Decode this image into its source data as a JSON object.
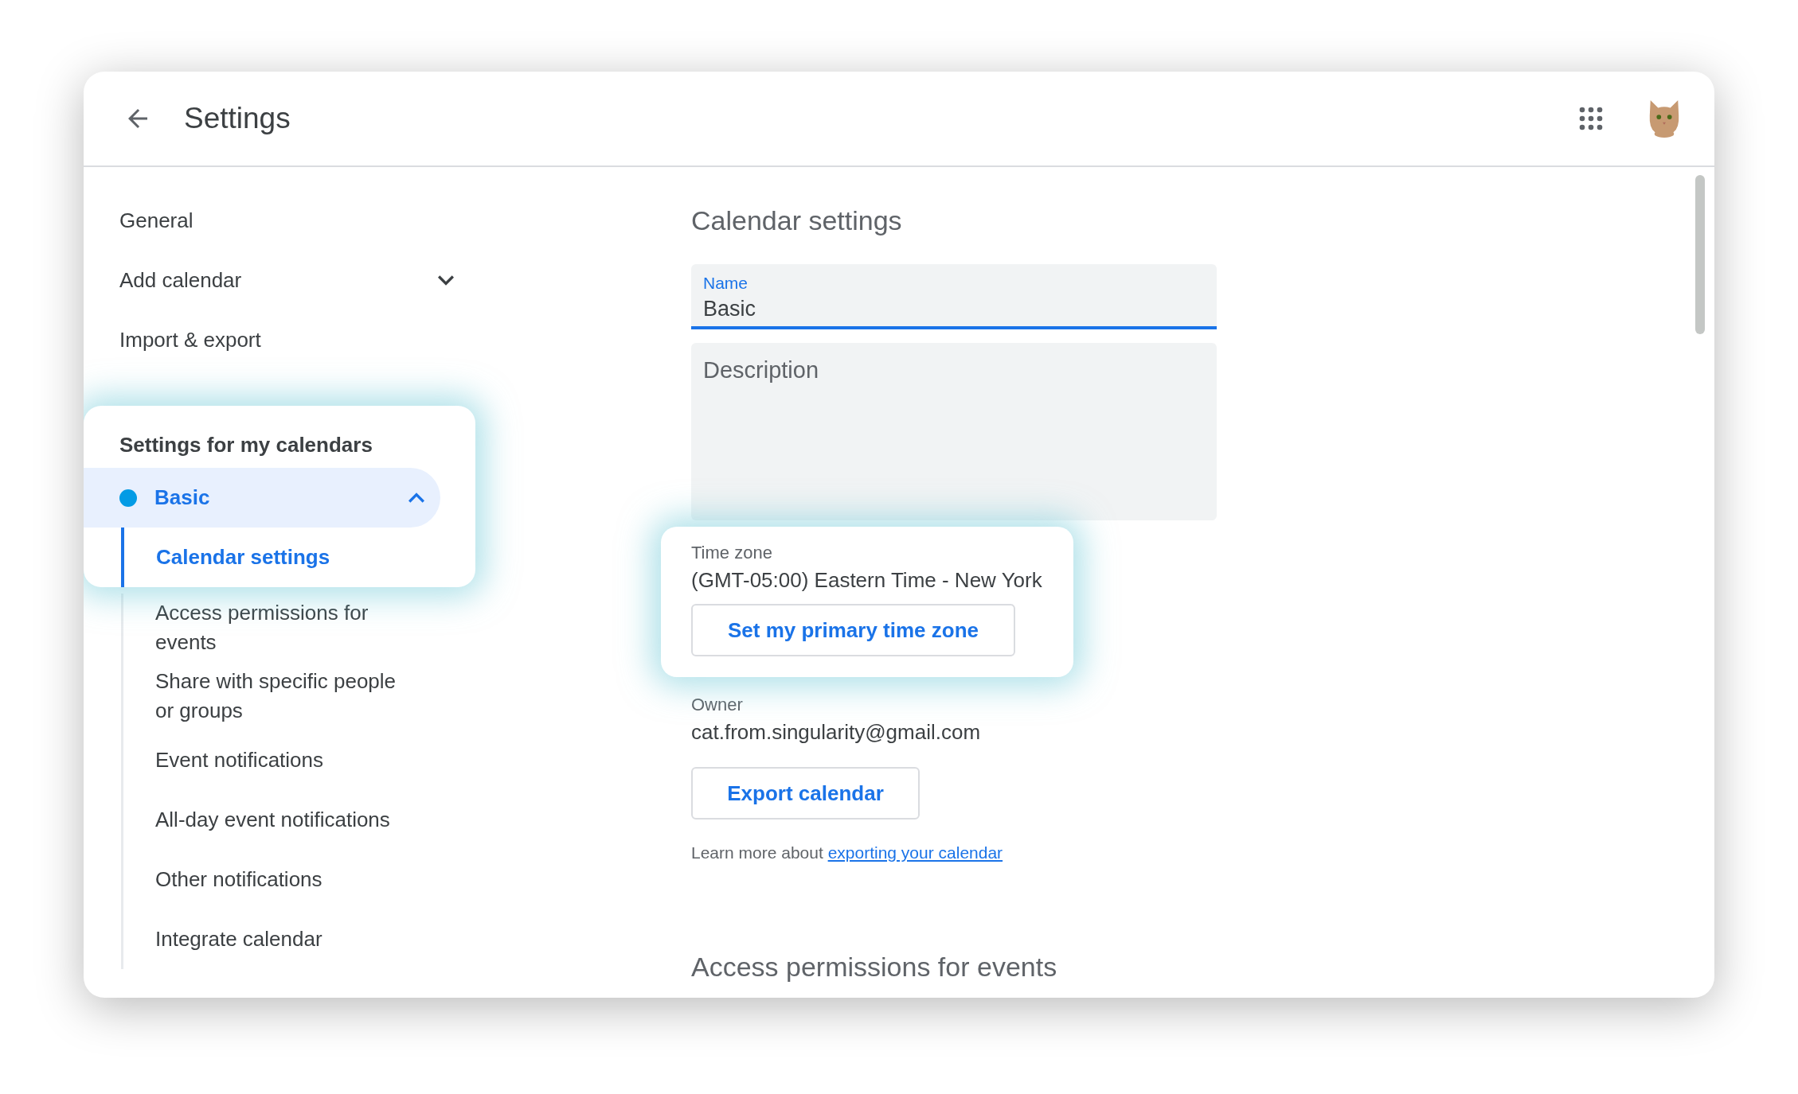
{
  "header": {
    "title": "Settings"
  },
  "sidebar": {
    "items": [
      {
        "label": "General",
        "kind": "link"
      },
      {
        "label": "Add calendar",
        "kind": "expandable",
        "expanded": false
      },
      {
        "label": "Import & export",
        "kind": "link"
      }
    ],
    "my_calendars": {
      "heading": "Settings for my calendars",
      "spotlight": true,
      "calendar": {
        "name": "Basic",
        "color": "#039be5",
        "expanded": true,
        "selected": true
      },
      "sub_items": [
        {
          "label": "Calendar settings",
          "selected": true,
          "spotlight": true
        },
        {
          "label": "Access permissions for events",
          "selected": false,
          "spotlight": false
        },
        {
          "label": "Share with specific people or groups",
          "selected": false,
          "spotlight": false
        },
        {
          "label": "Event notifications",
          "selected": false,
          "spotlight": false
        },
        {
          "label": "All-day event notifications",
          "selected": false,
          "spotlight": false
        },
        {
          "label": "Other notifications",
          "selected": false,
          "spotlight": false
        },
        {
          "label": "Integrate calendar",
          "selected": false,
          "spotlight": false
        }
      ]
    }
  },
  "main": {
    "heading": "Calendar settings",
    "name_field": {
      "label": "Name",
      "value": "Basic",
      "focused": true
    },
    "description_field": {
      "placeholder": "Description"
    },
    "time_zone": {
      "label": "Time zone",
      "value": "(GMT-05:00) Eastern Time - New York",
      "button": "Set my primary time zone",
      "spotlight": true
    },
    "owner": {
      "label": "Owner",
      "value": "cat.from.singularity@gmail.com"
    },
    "export_button": "Export calendar",
    "learn_more": {
      "text": "Learn more about",
      "link": "exporting your calendar"
    },
    "next_heading": "Access permissions for events"
  }
}
